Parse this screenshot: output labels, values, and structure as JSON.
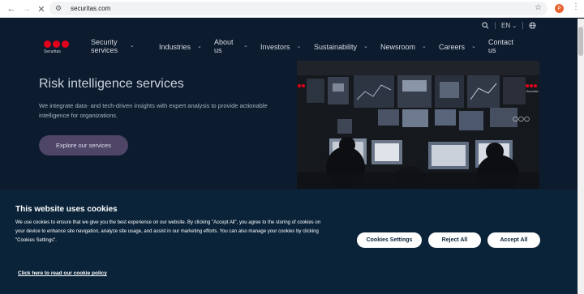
{
  "browser": {
    "url": "securitas.com",
    "profile_initial": "P"
  },
  "utility": {
    "language": "EN"
  },
  "logo": {
    "wordmark": "Securitas",
    "brand_color": "#e3001b"
  },
  "menu": {
    "items": [
      {
        "label": "Security services"
      },
      {
        "label": "Industries"
      },
      {
        "label": "About us"
      },
      {
        "label": "Investors"
      },
      {
        "label": "Sustainability"
      },
      {
        "label": "Newsroom"
      },
      {
        "label": "Careers"
      },
      {
        "label": "Contact us"
      }
    ]
  },
  "hero": {
    "title": "Risk intelligence services",
    "text": "We integrate data- and tech-driven insights with expert analysis to provide actionable intelligence for organizations.",
    "cta": "Explore our services",
    "image_wordmark": "Securitas"
  },
  "cookie": {
    "title": "This website uses cookies",
    "text": "We use cookies to ensure that we give you the best experience on our website. By clicking \"Accept All\", you agree to the storing of cookies on your device to enhance site navigation, analyze site usage, and assist in our marketing efforts. You can also manage your cookies by clicking \"Cookies Settings\".",
    "settings_label": "Cookies Settings",
    "reject_label": "Reject All",
    "accept_label": "Accept All",
    "policy_link": "Click here to read our cookie policy"
  },
  "colors": {
    "background": "#0d1b2e",
    "banner": "#0a2339",
    "cta": "#4e4567"
  }
}
